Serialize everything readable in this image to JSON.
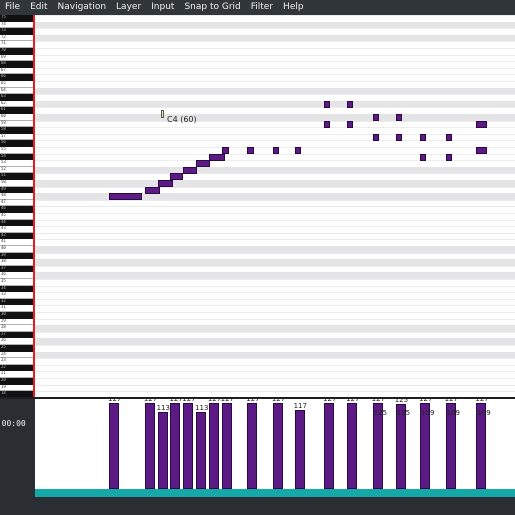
{
  "menu": [
    "File",
    "Edit",
    "Navigation",
    "Layer",
    "Input",
    "Snap to Grid",
    "Filter",
    "Help"
  ],
  "piano": {
    "labels": [
      "75",
      "74",
      "73",
      "72",
      "71",
      "70",
      "69",
      "68",
      "67",
      "66",
      "65",
      "64",
      "63",
      "62",
      "61",
      "60",
      "59",
      "58",
      "57",
      "56",
      "55",
      "54",
      "53",
      "52",
      "51",
      "50",
      "49",
      "48",
      "47",
      "46",
      "45",
      "44",
      "43",
      "42",
      "41",
      "40",
      "39",
      "38",
      "37",
      "36",
      "35",
      "34",
      "33",
      "32",
      "31",
      "30",
      "29",
      "28",
      "27",
      "26",
      "25",
      "24",
      "23",
      "22",
      "21",
      "20",
      "19",
      "18"
    ]
  },
  "hover": {
    "label": "C4 (60)"
  },
  "time": {
    "readout": "0:00:00"
  },
  "notes": [
    {
      "pitch": 48,
      "start": 0,
      "dur": 2.6,
      "velocity": 127
    },
    {
      "pitch": 49,
      "start": 2.8,
      "dur": 1.2,
      "velocity": 127
    },
    {
      "pitch": 50,
      "start": 3.8,
      "dur": 1.2,
      "velocity": 113
    },
    {
      "pitch": 51,
      "start": 4.8,
      "dur": 1.0,
      "velocity": 127
    },
    {
      "pitch": 52,
      "start": 5.8,
      "dur": 1.1,
      "velocity": 127
    },
    {
      "pitch": 53,
      "start": 6.8,
      "dur": 1.1,
      "velocity": 113
    },
    {
      "pitch": 54,
      "start": 7.8,
      "dur": 1.3,
      "velocity": 127
    },
    {
      "pitch": 55,
      "start": 8.8,
      "dur": 0.6,
      "velocity": 127
    },
    {
      "pitch": 55,
      "start": 10.8,
      "dur": 0.5,
      "velocity": 127
    },
    {
      "pitch": 55,
      "start": 12.8,
      "dur": 0.5,
      "velocity": 127
    },
    {
      "pitch": 55,
      "start": 14.5,
      "dur": 0.5,
      "velocity": 117
    },
    {
      "pitch": 62,
      "start": 16.8,
      "dur": 0.5,
      "velocity": 127
    },
    {
      "pitch": 59,
      "start": 16.8,
      "dur": 0.3,
      "velocity": 127
    },
    {
      "pitch": 62,
      "start": 18.6,
      "dur": 0.5,
      "velocity": 127
    },
    {
      "pitch": 59,
      "start": 18.6,
      "dur": 0.4,
      "velocity": 127
    },
    {
      "pitch": 60,
      "start": 20.6,
      "dur": 0.5,
      "velocity": 127
    },
    {
      "pitch": 57,
      "start": 20.6,
      "dur": 0.5,
      "velocity": 127
    },
    {
      "pitch": 60,
      "start": 22.4,
      "dur": 0.4,
      "velocity": 125
    },
    {
      "pitch": 57,
      "start": 22.4,
      "dur": 0.4,
      "velocity": 127
    },
    {
      "pitch": 57,
      "start": 24.3,
      "dur": 0.3,
      "velocity": 127
    },
    {
      "pitch": 54,
      "start": 24.3,
      "dur": 0.4,
      "velocity": 127
    },
    {
      "pitch": 57,
      "start": 26.3,
      "dur": 0.4,
      "velocity": 127
    },
    {
      "pitch": 54,
      "start": 26.3,
      "dur": 0.4,
      "velocity": 127
    },
    {
      "pitch": 59,
      "start": 28.7,
      "dur": 0.8,
      "velocity": 127
    },
    {
      "pitch": 55,
      "start": 28.7,
      "dur": 0.8,
      "velocity": 127
    }
  ],
  "velocity_labels_extra": [
    {
      "start": 20.6,
      "text": "125"
    },
    {
      "start": 22.4,
      "text": "125"
    },
    {
      "start": 24.3,
      "text": "109"
    },
    {
      "start": 26.3,
      "text": "109"
    },
    {
      "start": 28.7,
      "text": "109"
    }
  ],
  "colors": {
    "note": "#5b1a84",
    "velocity_base": "#14a8a8",
    "piano_edge": "#e02020"
  }
}
